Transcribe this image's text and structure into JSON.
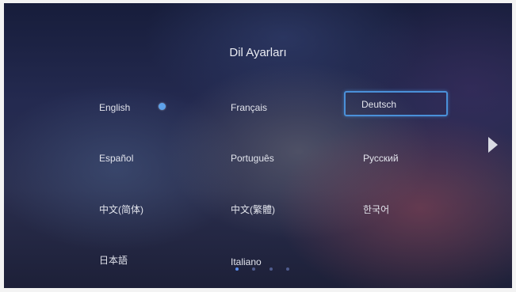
{
  "screen": {
    "title": "Dil Ayarları"
  },
  "languages": [
    {
      "label": "English",
      "selected": true,
      "focused": false
    },
    {
      "label": "Français",
      "selected": false,
      "focused": false
    },
    {
      "label": "Deutsch",
      "selected": false,
      "focused": true
    },
    {
      "label": "Español",
      "selected": false,
      "focused": false
    },
    {
      "label": "Português",
      "selected": false,
      "focused": false
    },
    {
      "label": "Русский",
      "selected": false,
      "focused": false
    },
    {
      "label": "中文(简体)",
      "selected": false,
      "focused": false
    },
    {
      "label": "中文(繁體)",
      "selected": false,
      "focused": false
    },
    {
      "label": "한국어",
      "selected": false,
      "focused": false
    },
    {
      "label": "日本語",
      "selected": false,
      "focused": false
    },
    {
      "label": "Italiano",
      "selected": false,
      "focused": false
    }
  ],
  "pagination": {
    "page_count": 4,
    "current_page": 1
  },
  "icons": {
    "next_page": "chevron-right-icon",
    "selected_indicator": "radio-dot-icon"
  },
  "colors": {
    "focus_border": "#4a90d9",
    "selected_dot": "#5ea2ea",
    "text": "#e2e4ec"
  }
}
